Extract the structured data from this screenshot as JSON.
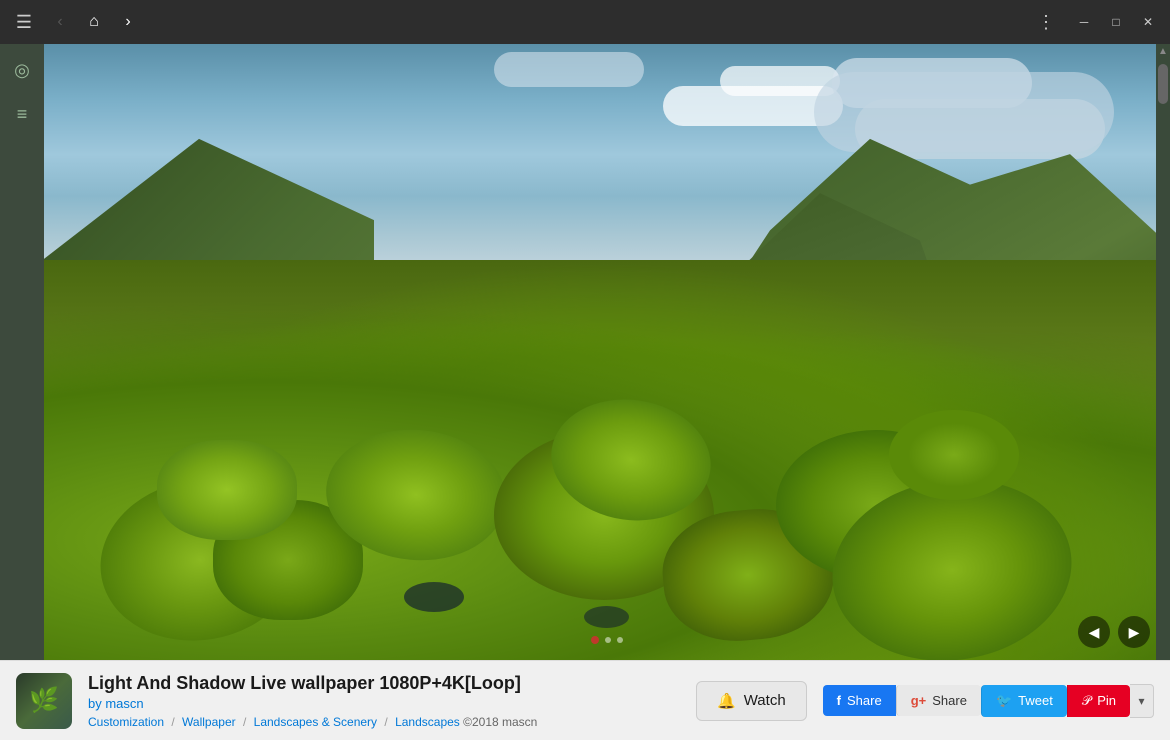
{
  "titlebar": {
    "menu_label": "☰",
    "back_label": "‹",
    "home_label": "⌂",
    "forward_label": "›",
    "dots_label": "⋮",
    "minimize_label": "─",
    "maximize_label": "□",
    "close_label": "✕"
  },
  "sidebar": {
    "compass_icon": "◎",
    "list_icon": "≡"
  },
  "image": {
    "alt": "Light And Shadow Live wallpaper - mossy green rocks on a beach with mountains"
  },
  "info_bar": {
    "title": "Light And Shadow Live wallpaper 1080P+4K[Loop]",
    "author_prefix": "by ",
    "author": "mascn",
    "breadcrumb": {
      "customization": "Customization",
      "sep1": " / ",
      "wallpaper": "Wallpaper",
      "sep2": " / ",
      "landscapes_scenery": "Landscapes & Scenery",
      "sep3": " / ",
      "landscapes": "Landscapes",
      "sep4": " ",
      "copyright": "©2018 mascn"
    },
    "watch_label": "Watch",
    "watch_icon": "🔔",
    "social": {
      "share_fb_label": "Share",
      "share_gplus_label": "Share",
      "tweet_label": "Tweet",
      "pin_label": "Pin",
      "more_label": "▾"
    }
  },
  "scrollbar": {
    "up_arrow": "▲",
    "down_arrow": "▼"
  }
}
